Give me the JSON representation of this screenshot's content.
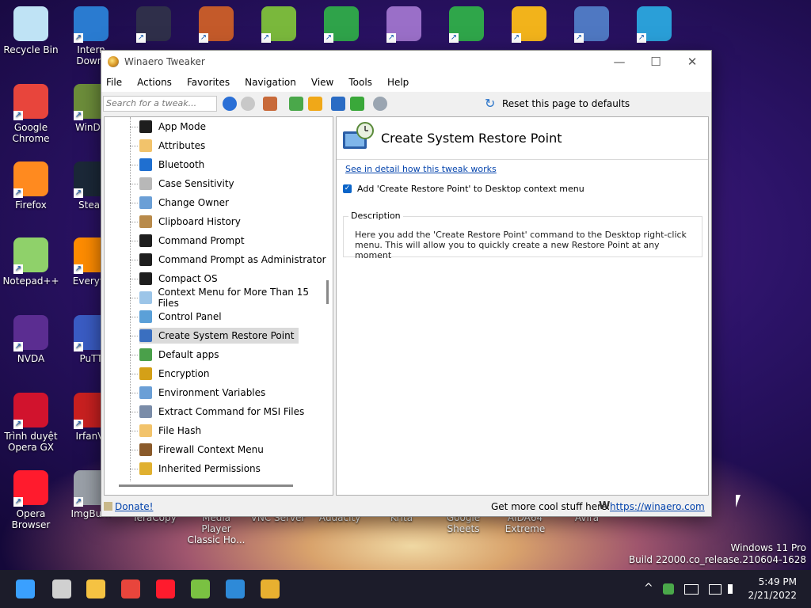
{
  "desktop": {
    "left_column": [
      {
        "name": "recycle-bin",
        "label": "Recycle Bin",
        "color": "#bfe3f5"
      },
      {
        "name": "google-chrome",
        "label": "Google\nChrome",
        "color": "#e8453c"
      },
      {
        "name": "firefox",
        "label": "Firefox",
        "color": "#ff8a1f"
      },
      {
        "name": "notepad-plus-plus",
        "label": "Notepad++",
        "color": "#8fd16a"
      },
      {
        "name": "nvda",
        "label": "NVDA",
        "color": "#5b2d91"
      },
      {
        "name": "opera-gx",
        "label": "Trình duyệt\nOpera GX",
        "color": "#d1132d"
      },
      {
        "name": "opera-browser",
        "label": "Opera\nBrowser",
        "color": "#ff1b2d"
      }
    ],
    "second_column": [
      {
        "name": "internet-download-manager",
        "label": "Intern\nDownl",
        "color": "#2a7bd0"
      },
      {
        "name": "windirstat",
        "label": "WinDir",
        "color": "#6c8d3a"
      },
      {
        "name": "steam",
        "label": "Stear",
        "color": "#1b2838"
      },
      {
        "name": "everything",
        "label": "Everyth",
        "color": "#ff8c00"
      },
      {
        "name": "putty",
        "label": "PuTT",
        "color": "#3a5cc4"
      },
      {
        "name": "irfanview",
        "label": "IrfanVi",
        "color": "#c92020"
      },
      {
        "name": "imgburn",
        "label": "ImgBurn",
        "color": "#9aa0a8"
      }
    ],
    "bottom_labels": [
      "TeraCopy",
      "Media Player\nClassic Ho...",
      "VNC Server",
      "Audacity",
      "Krita",
      "Google\nSheets",
      "AIDA64\nExtreme",
      "Avira"
    ],
    "top_row_colors": [
      "#2f2f4a",
      "#c45a2a",
      "#7ab83c",
      "#2fa34a",
      "#9a6fc8",
      "#2fa64a",
      "#f2b31b",
      "#4f78c2",
      "#2a9fd8"
    ]
  },
  "window": {
    "title": "Winaero Tweaker",
    "controls": {
      "minimize": "—",
      "maximize": "☐",
      "close": "✕"
    },
    "menu": [
      "File",
      "Actions",
      "Favorites",
      "Navigation",
      "View",
      "Tools",
      "Help"
    ],
    "search_placeholder": "Search for a tweak...",
    "reset_label": "Reset this page to defaults",
    "tree_items": [
      {
        "label": "App Mode",
        "color": "#1e1e1e"
      },
      {
        "label": "Attributes",
        "color": "#f2c36b"
      },
      {
        "label": "Bluetooth",
        "color": "#1f6fd0"
      },
      {
        "label": "Case Sensitivity",
        "color": "#b8b8b8"
      },
      {
        "label": "Change Owner",
        "color": "#6b9fd6"
      },
      {
        "label": "Clipboard History",
        "color": "#b88a4a"
      },
      {
        "label": "Command Prompt",
        "color": "#1e1e1e"
      },
      {
        "label": "Command Prompt as Administrator",
        "color": "#1e1e1e"
      },
      {
        "label": "Compact OS",
        "color": "#1e1e1e"
      },
      {
        "label": "Context Menu for More Than 15 Files",
        "color": "#9cc5e8"
      },
      {
        "label": "Control Panel",
        "color": "#5ba0d8"
      },
      {
        "label": "Create System Restore Point",
        "color": "#3a6fc0"
      },
      {
        "label": "Default apps",
        "color": "#4aa04a"
      },
      {
        "label": "Encryption",
        "color": "#d4a017"
      },
      {
        "label": "Environment Variables",
        "color": "#6b9fd6"
      },
      {
        "label": "Extract Command for MSI Files",
        "color": "#7a8ca8"
      },
      {
        "label": "File Hash",
        "color": "#f2c36b"
      },
      {
        "label": "Firewall Context Menu",
        "color": "#8a5a2a"
      },
      {
        "label": "Inherited Permissions",
        "color": "#e0b030"
      }
    ],
    "selected_index": 11,
    "page_title": "Create System Restore Point",
    "detail_link": "See in detail how this tweak works",
    "option_label": "Add 'Create Restore Point' to Desktop context menu",
    "option_checked": true,
    "description_legend": "Description",
    "description_text": "Here you add the 'Create Restore Point' command to the Desktop right-click menu. This will allow you to quickly create a new Restore Point at any moment",
    "donate": "Donate!",
    "more_text": "Get more cool stuff here:",
    "wlogo": "W",
    "url": "https://winaero.com"
  },
  "watermark": {
    "line1": "Windows 11 Pro",
    "line2": "Build 22000.co_release.210604-1628"
  },
  "taskbar": {
    "apps": [
      {
        "name": "start",
        "color": "#3aa0ff"
      },
      {
        "name": "task-view",
        "color": "#d0d0d0"
      },
      {
        "name": "file-explorer",
        "color": "#f5c242"
      },
      {
        "name": "chrome",
        "color": "#e8453c"
      },
      {
        "name": "opera",
        "color": "#ff1b2d"
      },
      {
        "name": "bluestacks",
        "color": "#7ac142"
      },
      {
        "name": "control-panel",
        "color": "#2e8ad8"
      },
      {
        "name": "winaero-tweaker",
        "color": "#e8b030"
      }
    ],
    "tray_chevron": "^",
    "time": "5:49 PM",
    "date": "2/21/2022"
  }
}
